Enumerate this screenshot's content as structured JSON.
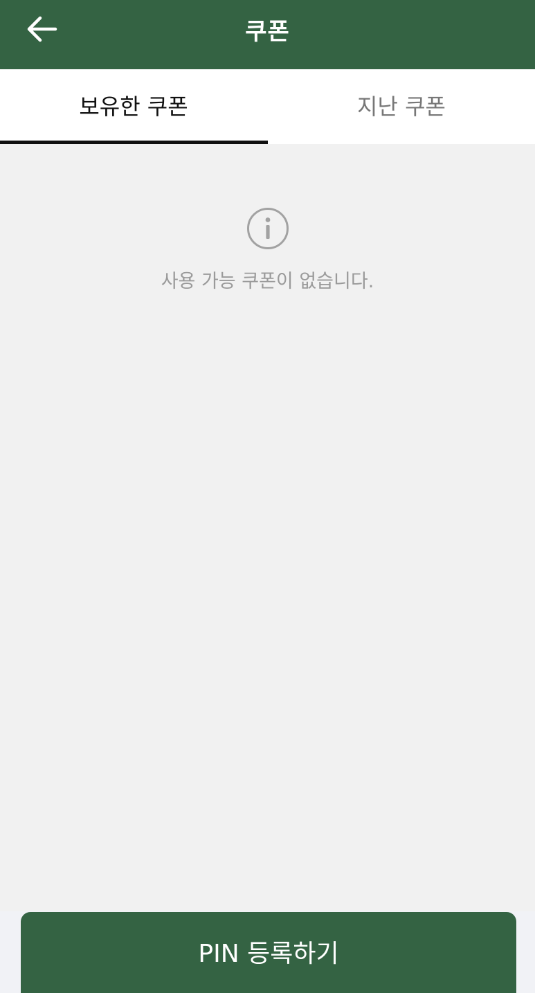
{
  "header": {
    "title": "쿠폰",
    "back_icon": "arrow-left-icon"
  },
  "tabs": [
    {
      "label": "보유한 쿠폰",
      "active": true
    },
    {
      "label": "지난 쿠폰",
      "active": false
    }
  ],
  "empty_state": {
    "icon": "info-icon",
    "message": "사용 가능 쿠폰이 없습니다."
  },
  "footer": {
    "pin_button_label": "PIN 등록하기"
  },
  "colors": {
    "brand_green": "#346343",
    "background": "#f1f1f1",
    "active_tab_text": "#111111",
    "inactive_tab_text": "#777777",
    "muted_text": "#9a9a9a"
  }
}
